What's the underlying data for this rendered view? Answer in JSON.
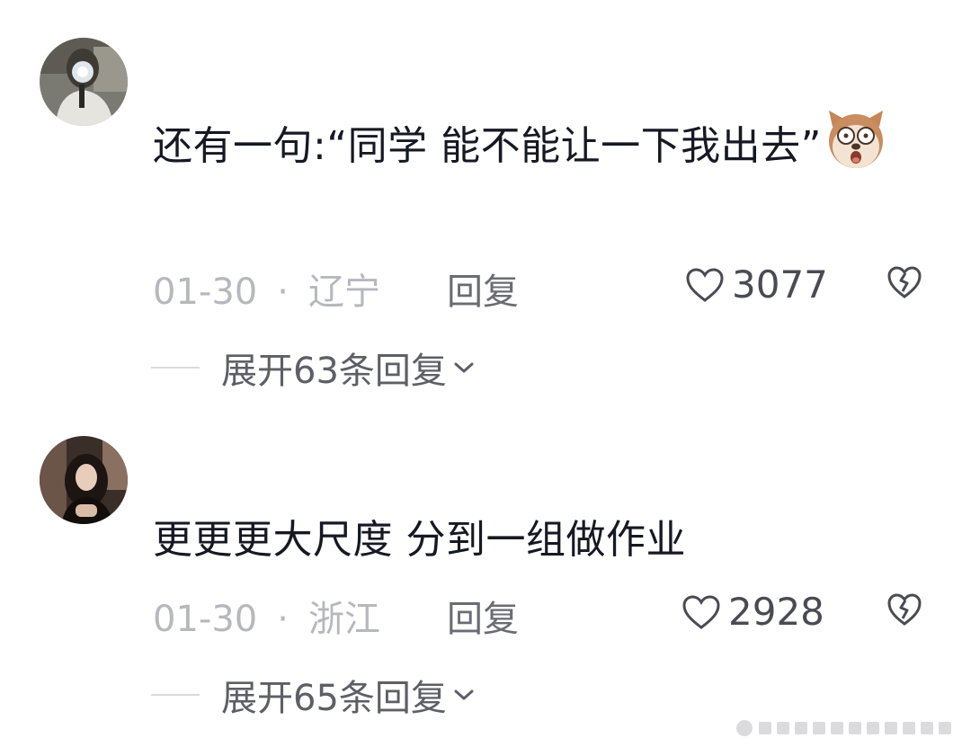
{
  "comments": [
    {
      "text": "还有一句:“同学 能不能让一下我出去”",
      "emoji_icon": "surprised-dog-emoji",
      "date": "01-30",
      "separator": "·",
      "location": "辽宁",
      "reply_label": "回复",
      "likes": "3077",
      "expand_label": "展开63条回复"
    },
    {
      "text": "更更更大尺度 分到一组做作业",
      "date": "01-30",
      "separator": "·",
      "location": "浙江",
      "reply_label": "回复",
      "likes": "2928",
      "expand_label": "展开65条回复"
    }
  ],
  "colors": {
    "text": "#161823",
    "meta": "#b7b8bd",
    "reply": "#6b6c73",
    "likes": "#4a4b52",
    "expand": "#5e5f66"
  }
}
